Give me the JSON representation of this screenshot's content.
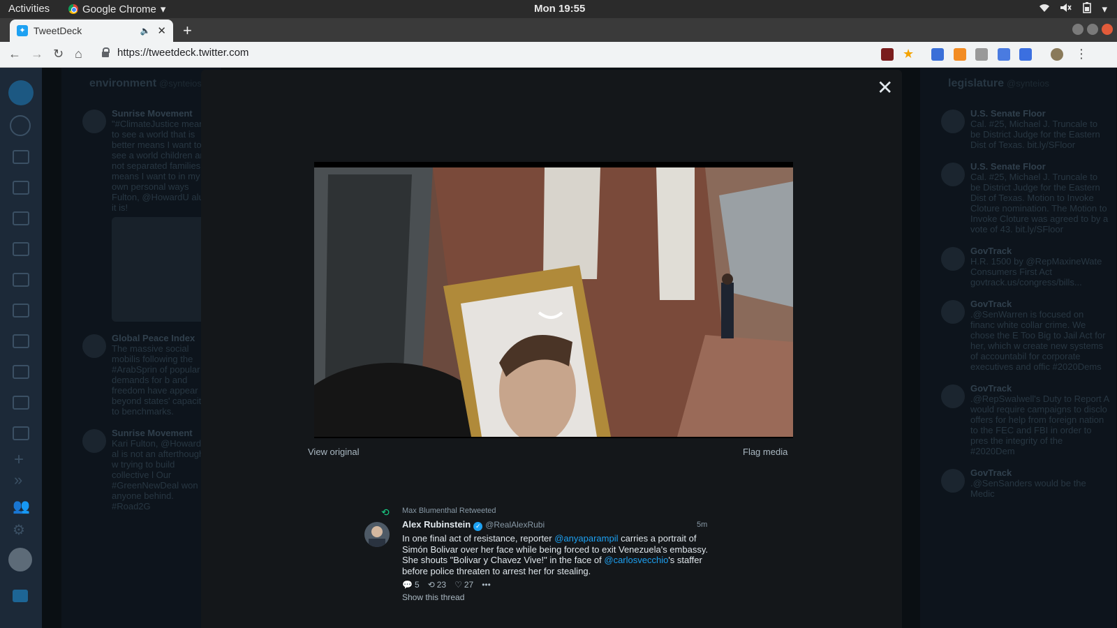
{
  "os_bar": {
    "activities": "Activities",
    "app_name": "Google Chrome",
    "clock": "Mon 19:55",
    "tray_icons": [
      "wifi-icon",
      "volume-icon",
      "battery-icon",
      "power-menu-icon"
    ]
  },
  "browser": {
    "tab_title": "TweetDeck",
    "new_tab": "+",
    "url": "https://tweetdeck.twitter.com"
  },
  "columns": [
    {
      "title": "environment",
      "handle": "@synteios",
      "tweets": [
        {
          "name": "Sunrise Movement",
          "text": "\"#ClimateJustice means to see a world that is better means I want to see a world children are not separated families. It means I want to in my own personal ways Fulton, @HowardU alum it is!"
        },
        {
          "name": "Global Peace Index",
          "text": "The massive social mobilis following the #ArabSprin of popular demands for b and freedom have appear beyond states' capacity to benchmarks."
        },
        {
          "name": "Sunrise Movement",
          "text": "Kari Fulton, @HowardU al is not an afterthought if w trying to build collective l Our #GreenNewDeal won anyone behind. #Road2G"
        }
      ]
    },
    {
      "title": "legislature",
      "handle": "@synteios",
      "tweets": [
        {
          "name": "U.S. Senate Floor",
          "text": "Cal. #25, Michael J. Truncale to be District Judge for the Eastern Dist of Texas. bit.ly/SFloor"
        },
        {
          "name": "U.S. Senate Floor",
          "text": "Cal. #25, Michael J. Truncale to be District Judge for the Eastern Dist of Texas. Motion to Invoke Cloture nomination. The Motion to Invoke Cloture was agreed to by a vote of 43. bit.ly/SFloor"
        },
        {
          "name": "GovTrack",
          "text": "H.R. 1500 by @RepMaxineWate Consumers First Act govtrack.us/congress/bills..."
        },
        {
          "name": "GovTrack",
          "text": ".@SenWarren is focused on financ white collar crime. We chose the E Too Big to Jail Act for her, which w create new systems of accountabil for corporate executives and offic #2020Dems"
        },
        {
          "name": "GovTrack",
          "text": ".@RepSwalwell's Duty to Report A would require campaigns to disclo offers for help from foreign nation to the FEC and FBI in order to pres the integrity of the #2020Dem"
        },
        {
          "name": "GovTrack",
          "text": ".@SenSanders would be the Medic"
        }
      ]
    }
  ],
  "modal": {
    "view_original": "View original",
    "flag_media": "Flag media",
    "retweeted_by": "Max Blumenthal Retweeted",
    "tweet": {
      "author_name": "Alex Rubinstein",
      "author_handle": "@RealAlexRubi",
      "time": "5m",
      "text_parts": {
        "p1": "In one final act of resistance, reporter ",
        "m1": "@anyaparampil",
        "p2": " carries a portrait of Simón Bolivar over her face while being forced to exit Venezuela's embassy. She shouts \"Bolivar y Chavez Vive!\" in the face of ",
        "m2": "@carlosvecchio",
        "p3": "'s staffer before police threaten to arrest her for stealing."
      },
      "replies": "5",
      "retweets": "23",
      "likes": "27",
      "show_thread": "Show this thread"
    }
  },
  "colors": {
    "twitter_blue": "#1da1f2",
    "retweet_green": "#19cf86",
    "modal_bg": "#14171a"
  }
}
